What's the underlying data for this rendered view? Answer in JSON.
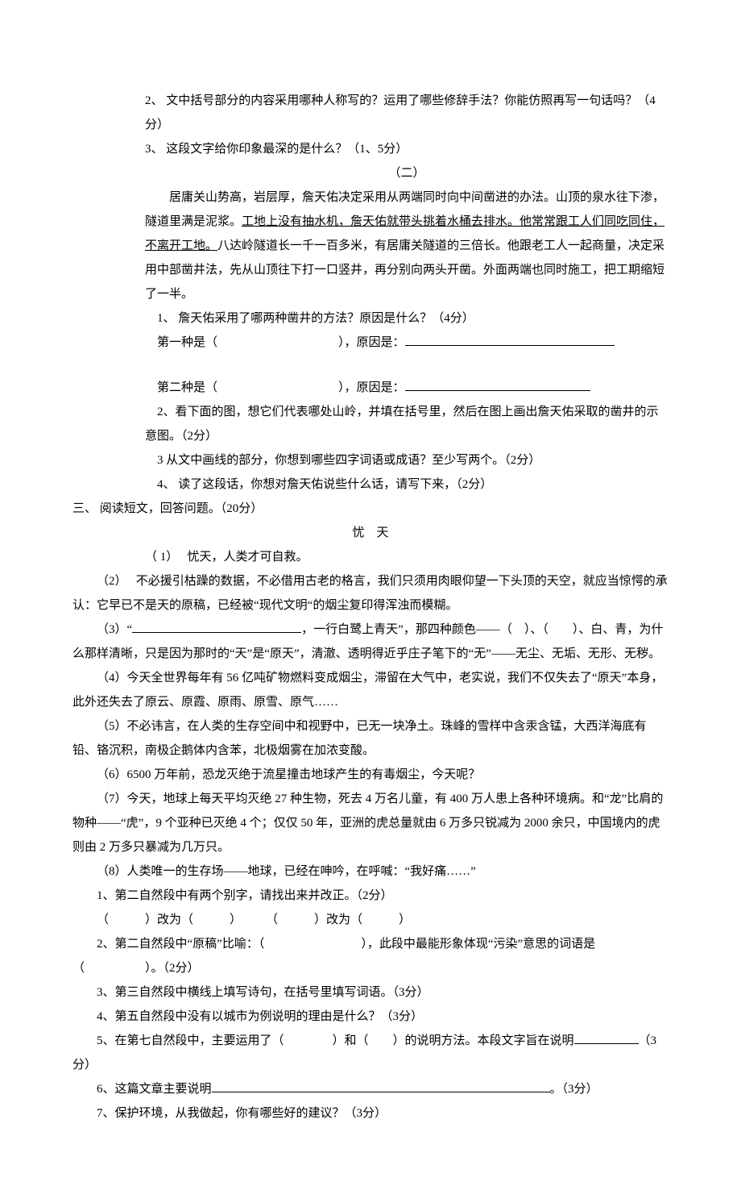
{
  "q2": "2、 文中括号部分的内容采用哪种人称写的？运用了哪些修辞手法？你能仿照再写一句话吗？（4分）",
  "q3": "3、 这段文字给你印象最深的是什么？（1、5分）",
  "section2_title": "（二）",
  "passage2_a": "　　居庸关山势高，岩层厚，詹天佑决定采用从两端同时向中间凿进的办法。山顶的泉水往下渗，隧道里满是泥浆。",
  "passage2_u": "工地上没有抽水机，詹天佑就带头挑着水桶去排水。他常常跟工人们同吃同住，不离开工地。",
  "passage2_b": "八达岭隧道长一千一百多米，有居庸关隧道的三倍长。他跟老工人一起商量，决定采用中部凿井法，先从山顶往下打一口竖井，再分别向两头开凿。外面两端也同时施工，把工期缩短了一半。",
  "p2q1": "1、 詹天佑采用了哪两种凿井的方法？原因是什么？（4分）",
  "p2q1_a": "第一种是（　　　　　　　　　　），原因是：",
  "p2q1_b": "第二种是（　　　　　　　　　　），原因是：",
  "p2q2": "2、看下面的图，想它们代表哪处山岭，并填在括号里，然后在图上画出詹天佑采取的凿井的示意图。（2分）",
  "p2q3": "3 从文中画线的部分，你想到哪些四字词语或成语？至少写两个。（2分）",
  "p2q4": "4、 读了这段话，你想对詹天佑说些什么话，请写下来，（2分）",
  "section3_heading": "三、 阅读短文，回答问题。（20分）",
  "title3": "忧 天",
  "para1": "（ 1）　 忧天，人类才可自救。",
  "para2": "（2）　 不必援引枯躁的数据，不必借用古老的格言，我们只须用肉眼仰望一下头顶的天空，就应当惊愕的承认：它早已不是天的原稿，已经被“现代文明“的烟尘复印得浑浊而模糊。",
  "para3_a": "（3）“",
  "para3_b": "，一行白鹭上青天”，那四种颜色——（　）、（　　）、白、青，为什么那样清晰，只是因为那时的“天”是“原天”，清澈、透明得近乎庄子笔下的“无”——无尘、无垢、无形、无秽。",
  "para4": "（4）今天全世界每年有 56 亿吨矿物燃料变成烟尘，滞留在大气中，老实说，我们不仅失去了“原天”本身，此外还失去了原云、原霞、原雨、原雪、原气……",
  "para5": "（5）不必讳言，在人类的生存空间中和视野中，已无一块净土。珠峰的雪样中含汞含锰，大西洋海底有铅、铬沉积，南极企鹅体内含苯，北极烟雾在加浓变酸。",
  "para6": "（6）6500 万年前，恐龙灭绝于流星撞击地球产生的有毒烟尘，今天呢？",
  "para7": "（7）今天，地球上每天平均灭绝 27 种生物，死去 4 万名儿童，有 400 万人患上各种环境病。和“龙”比肩的物种——“虎”，9 个亚种已灭绝 4 个；仅仅 50 年，亚洲的虎总量就由 6 万多只锐减为 2000 余只，中国境内的虎则由 2 万多只暴减为几万只。",
  "para8": "（8）人类唯一的生存场——地球，已经在呻吟，在呼喊：“我好痛……”",
  "rq1": "1、第二自然段中有两个别字，请找出来并改正。（2分）",
  "rq1_b": "（　　　）改为（　　　）　　　（　　　）改为（　　　）",
  "rq2_a": "2、第二自然段中“原稿”比喻：（　　　　　　　　），此段中最能形象体现“污染”意思的词语是（　　　　　）。（2分）",
  "rq3": "3、第三自然段中横线上填写诗句，在括号里填写词语。（3分）",
  "rq4": "4、第五自然段中没有以城市为例说明的理由是什么？（3分）",
  "rq5_a": "5、在第七自然段中，主要运用了（　　　　）和（　　）的说明方法。本段文字旨在说明",
  "rq5_b": "（3分）",
  "rq6_a": "6、这篇文章主要说明",
  "rq6_b": "。（3分）",
  "rq7": "7、保护环境，从我做起，你有哪些好的建议？（3分）"
}
